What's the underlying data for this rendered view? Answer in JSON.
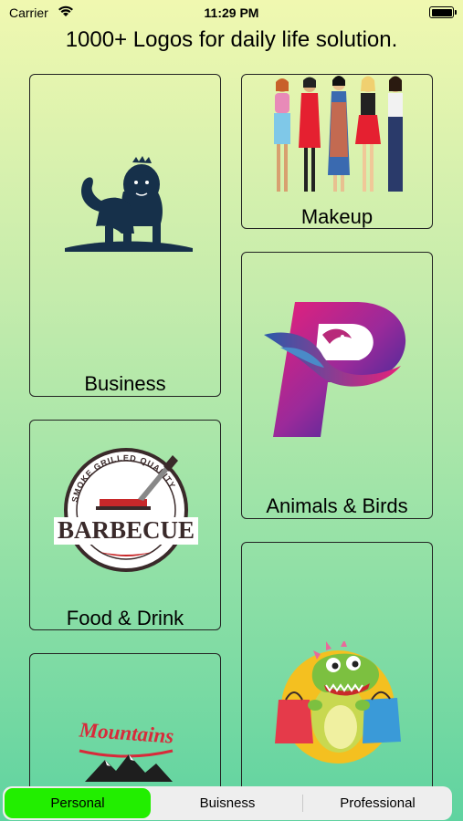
{
  "status_bar": {
    "carrier": "Carrier",
    "time": "11:29 PM"
  },
  "headline": "1000+ Logos for daily life solution.",
  "categories": [
    {
      "label": "Business"
    },
    {
      "label": "Makeup"
    },
    {
      "label": "Animals & Birds"
    },
    {
      "label": "Food & Drink"
    },
    {
      "label": ""
    },
    {
      "label": ""
    }
  ],
  "logos": {
    "barbecue_ring": "SMOKE GRILLED QUALITY",
    "barbecue_word": "BARBECUE",
    "mountains_word": "Mountains",
    "pheonix_letter": "P"
  },
  "tabs": [
    {
      "label": "Personal",
      "selected": true
    },
    {
      "label": "Buisness",
      "selected": false
    },
    {
      "label": "Professional",
      "selected": false
    }
  ],
  "colors": {
    "active_tab": "#22ee00",
    "card_border": "#222222"
  }
}
